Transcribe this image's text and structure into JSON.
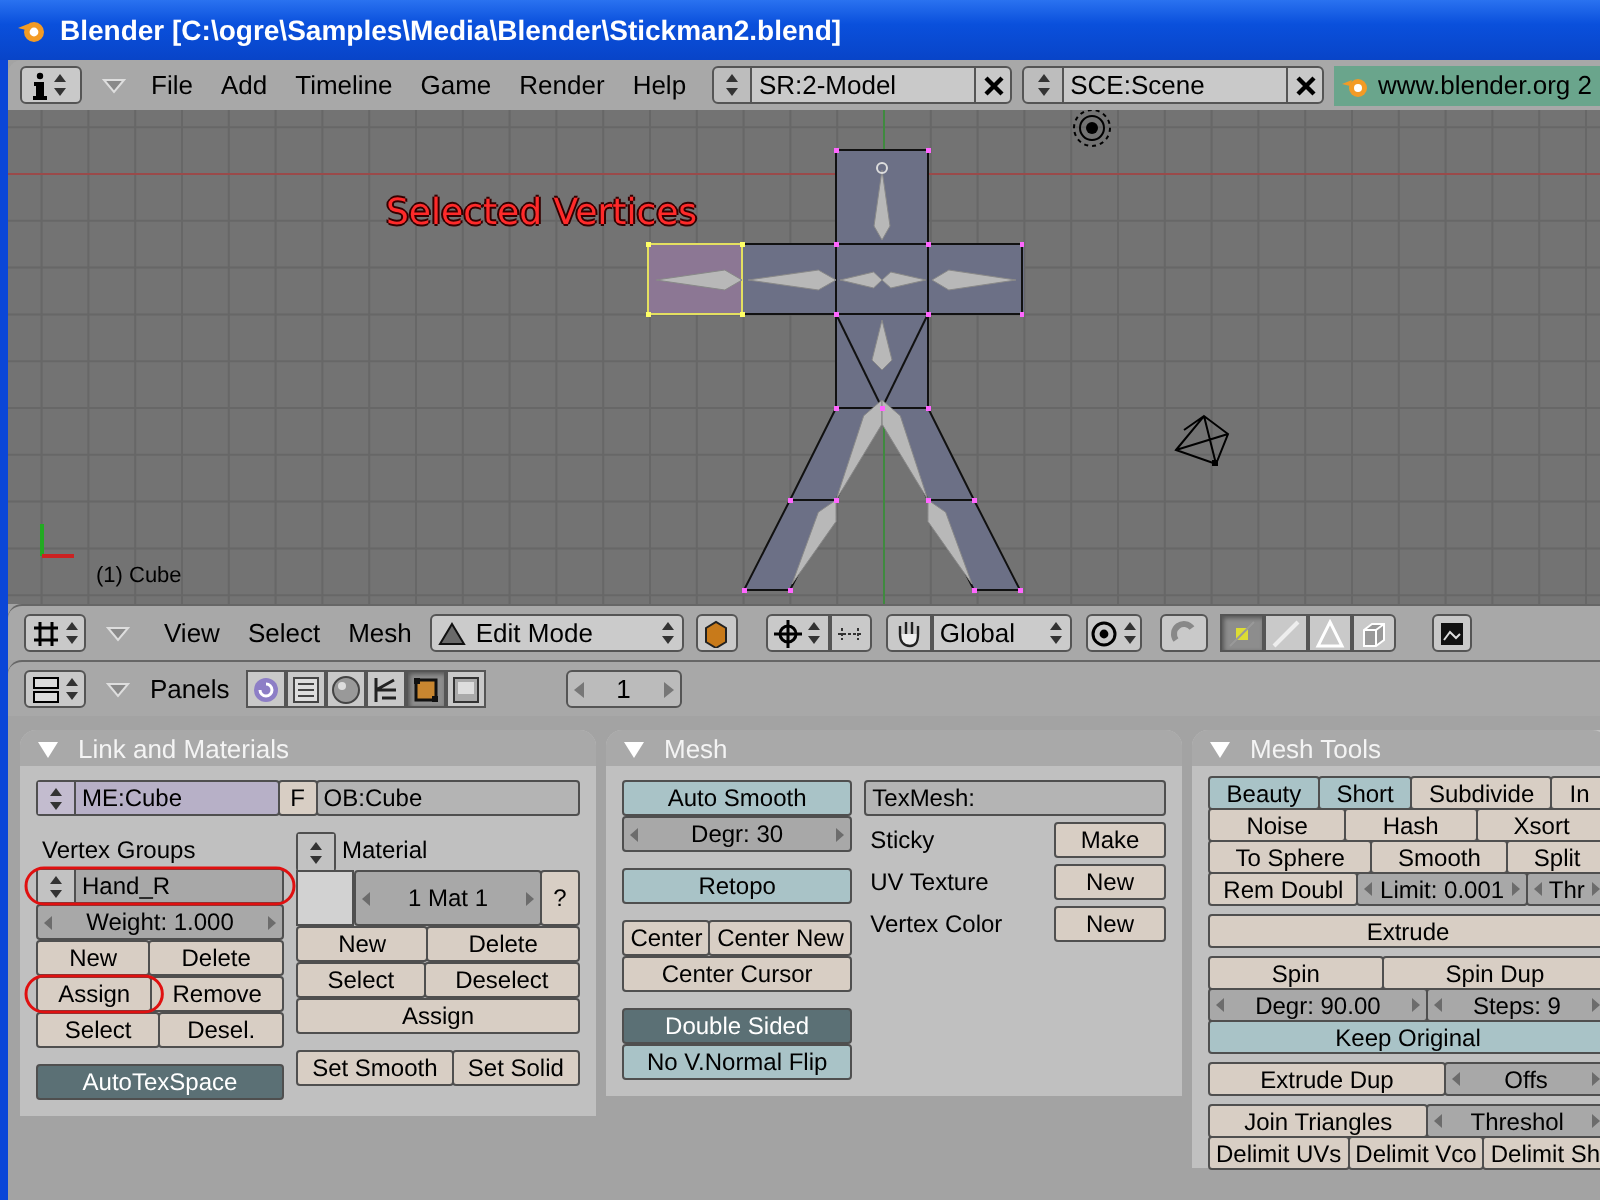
{
  "window": {
    "title": "Blender [C:\\ogre\\Samples\\Media\\Blender\\Stickman2.blend]"
  },
  "main_header": {
    "menus": [
      "File",
      "Add",
      "Timeline",
      "Game",
      "Render",
      "Help"
    ],
    "screen": "SR:2-Model",
    "scene": "SCE:Scene",
    "link": "www.blender.org 2"
  },
  "viewport": {
    "annotation": "Selected Vertices",
    "object_label": "(1) Cube"
  },
  "view3d_header": {
    "menus": [
      "View",
      "Select",
      "Mesh"
    ],
    "mode": "Edit Mode",
    "orientation": "Global",
    "select_modes": [
      {
        "kind": "vertex",
        "selected": true
      },
      {
        "kind": "edge",
        "selected": false
      },
      {
        "kind": "face",
        "selected": false
      }
    ]
  },
  "buttons_header": {
    "label": "Panels",
    "frame": "1",
    "context_tabs": [
      {
        "kind": "logic",
        "selected": false
      },
      {
        "kind": "script",
        "selected": false
      },
      {
        "kind": "shading",
        "selected": false
      },
      {
        "kind": "object",
        "selected": false
      },
      {
        "kind": "editing",
        "selected": true
      },
      {
        "kind": "scene",
        "selected": false
      }
    ]
  },
  "panels": [
    {
      "title": "Link and Materials",
      "expanded": true,
      "top": [
        [
          {
            "kind": "id-field",
            "label": "ME:Cube"
          },
          {
            "kind": "button",
            "label": "F"
          },
          {
            "kind": "text-field",
            "label": "OB:Cube"
          }
        ]
      ],
      "columns": [
        [
          [
            [
              {
                "kind": "label",
                "label": "Vertex Groups"
              }
            ],
            [
              {
                "kind": "menu",
                "label": "Hand_R",
                "circled": true
              }
            ],
            [
              {
                "kind": "number",
                "label": "Weight: 1.000"
              }
            ],
            [
              {
                "kind": "button",
                "label": "New"
              },
              {
                "kind": "button",
                "label": "Delete"
              }
            ],
            [
              {
                "kind": "button",
                "label": "Assign",
                "circled": true
              },
              {
                "kind": "button",
                "label": "Remove",
                "circled": false
              }
            ],
            [
              {
                "kind": "button",
                "label": "Select"
              },
              {
                "kind": "button",
                "label": "Desel."
              }
            ]
          ],
          [
            [
              {
                "kind": "toggle",
                "label": "AutoTexSpace",
                "on": true
              }
            ]
          ]
        ],
        [
          [
            [
              {
                "kind": "menu"
              },
              {
                "kind": "label",
                "label": "Material"
              }
            ],
            [
              {
                "kind": "swatch"
              },
              {
                "kind": "number",
                "label": "1 Mat 1"
              },
              {
                "kind": "button",
                "label": "?"
              }
            ],
            [
              {
                "kind": "button",
                "label": "New"
              },
              {
                "kind": "button",
                "label": "Delete"
              }
            ],
            [
              {
                "kind": "button",
                "label": "Select"
              },
              {
                "kind": "button",
                "label": "Deselect"
              }
            ],
            [
              {
                "kind": "button",
                "label": "Assign"
              }
            ]
          ],
          [
            [
              {
                "kind": "button",
                "label": "Set Smooth"
              },
              {
                "kind": "button",
                "label": "Set Solid"
              }
            ]
          ]
        ]
      ]
    },
    {
      "title": "Mesh",
      "expanded": true,
      "columns": [
        [
          [
            [
              {
                "kind": "toggle",
                "label": "Auto Smooth",
                "on": false
              }
            ],
            [
              {
                "kind": "number",
                "label": "Degr: 30"
              }
            ]
          ],
          [
            [
              {
                "kind": "toggle",
                "label": "Retopo",
                "on": false
              }
            ]
          ],
          [
            [
              {
                "kind": "button",
                "label": "Center"
              },
              {
                "kind": "button",
                "label": "Center New"
              }
            ],
            [
              {
                "kind": "button",
                "label": "Center Cursor"
              }
            ]
          ],
          [
            [
              {
                "kind": "toggle",
                "label": "Double Sided",
                "on": true
              }
            ],
            [
              {
                "kind": "toggle",
                "label": "No V.Normal Flip",
                "on": false
              }
            ]
          ]
        ],
        [
          [
            [
              {
                "kind": "text-field",
                "label": "TexMesh:"
              }
            ],
            [
              {
                "kind": "label",
                "label": "Sticky"
              },
              {
                "kind": "button",
                "label": "Make"
              }
            ],
            [
              {
                "kind": "label",
                "label": "UV Texture"
              },
              {
                "kind": "button",
                "label": "New"
              }
            ],
            [
              {
                "kind": "label",
                "label": "Vertex Color"
              },
              {
                "kind": "button",
                "label": "New"
              }
            ]
          ]
        ]
      ]
    },
    {
      "title": "Mesh Tools",
      "expanded": true,
      "columns": [
        [
          [
            [
              {
                "kind": "toggle",
                "label": "Beauty",
                "on": false
              },
              {
                "kind": "toggle",
                "label": "Short",
                "on": false
              },
              {
                "kind": "button",
                "label": "Subdivide"
              },
              {
                "kind": "button",
                "label": "In"
              }
            ],
            [
              {
                "kind": "button",
                "label": "Noise"
              },
              {
                "kind": "button",
                "label": "Hash"
              },
              {
                "kind": "button",
                "label": "Xsort"
              }
            ],
            [
              {
                "kind": "button",
                "label": "To Sphere"
              },
              {
                "kind": "button",
                "label": "Smooth"
              },
              {
                "kind": "button",
                "label": "Split"
              }
            ],
            [
              {
                "kind": "button",
                "label": "Rem Doubl"
              },
              {
                "kind": "number",
                "label": "Limit: 0.001"
              },
              {
                "kind": "number",
                "label": "Thr"
              }
            ]
          ],
          [
            [
              {
                "kind": "button",
                "label": "Extrude"
              }
            ]
          ],
          [
            [
              {
                "kind": "button",
                "label": "Spin"
              },
              {
                "kind": "button",
                "label": "Spin Dup"
              }
            ],
            [
              {
                "kind": "number",
                "label": "Degr: 90.00"
              },
              {
                "kind": "number",
                "label": "Steps: 9"
              }
            ],
            [
              {
                "kind": "toggle",
                "label": "Keep Original",
                "on": false
              }
            ]
          ],
          [
            [
              {
                "kind": "button",
                "label": "Extrude Dup"
              },
              {
                "kind": "number",
                "label": "Offs"
              }
            ]
          ],
          [
            [
              {
                "kind": "button",
                "label": "Join Triangles"
              },
              {
                "kind": "number",
                "label": "Threshol"
              }
            ],
            [
              {
                "kind": "button",
                "label": "Delimit UVs"
              },
              {
                "kind": "button",
                "label": "Delimit Vco"
              },
              {
                "kind": "button",
                "label": "Delimit Sh"
              }
            ]
          ]
        ]
      ]
    }
  ]
}
